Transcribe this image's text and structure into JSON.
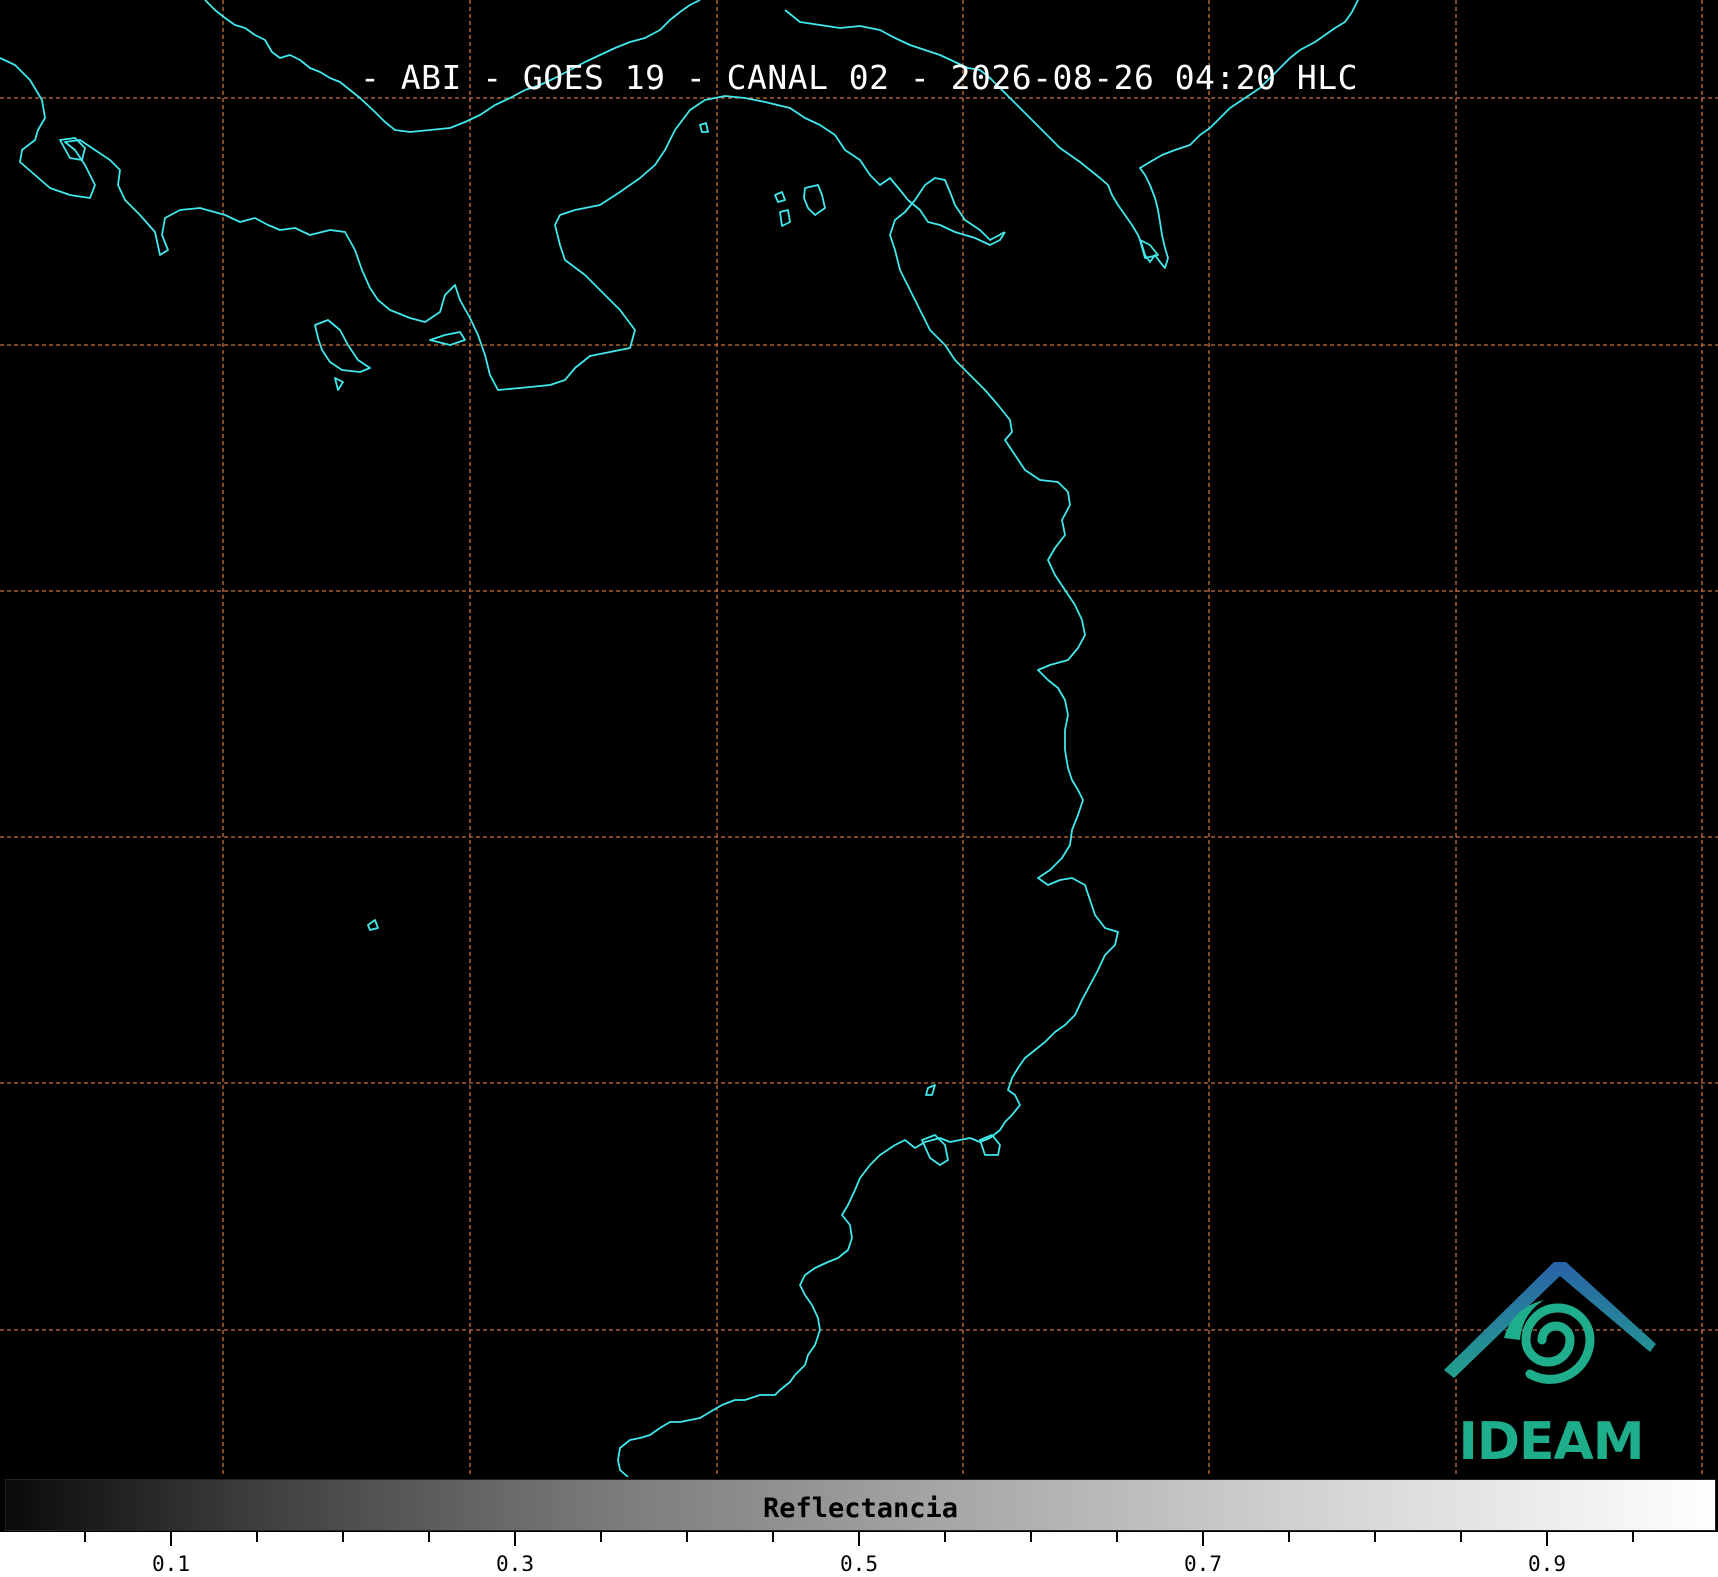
{
  "title": "- ABI - GOES 19 - CANAL 02 - 2026-08-26 04:20 HLC",
  "colors": {
    "background": "#000000",
    "coastline": "#40e8ec",
    "graticule": "#c8703c",
    "logo_blue": "#2a6aa8",
    "logo_green": "#1fae8c"
  },
  "logo": {
    "text": "IDEAM",
    "icon": "ideam-spiral-mountain-logo"
  },
  "colorbar": {
    "label": "Reflectancia",
    "range": [
      0.0,
      1.0
    ],
    "colormap": "grayscale",
    "major_ticks": [
      "0.1",
      "0.3",
      "0.5",
      "0.7",
      "0.9"
    ],
    "major_tick_values": [
      0.1,
      0.3,
      0.5,
      0.7,
      0.9
    ],
    "minor_tick_values": [
      0.05,
      0.15,
      0.2,
      0.25,
      0.35,
      0.4,
      0.45,
      0.55,
      0.6,
      0.65,
      0.75,
      0.8,
      0.85,
      0.95
    ]
  }
}
